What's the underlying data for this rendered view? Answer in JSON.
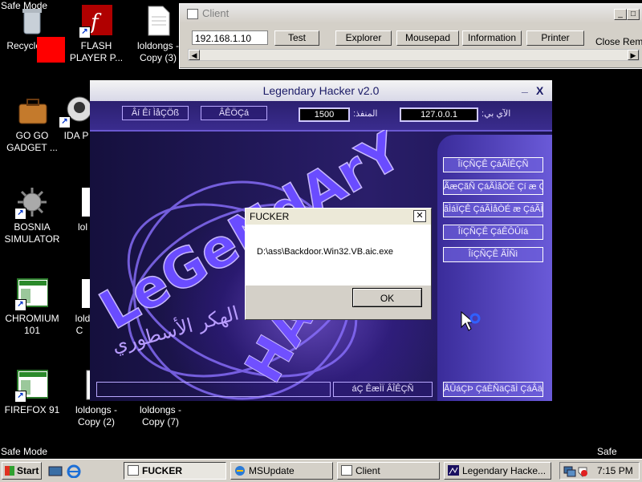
{
  "desktop": {
    "safe_mode_labels": [
      "Safe Mode",
      "Safe Mode",
      "Safe Mode"
    ],
    "icons": [
      {
        "label": "Recycle Bin"
      },
      {
        "label": "FLASH PLAYER P..."
      },
      {
        "label": "loldongs - Copy (3)"
      },
      {
        "label": "GO GO GADGET ..."
      },
      {
        "label": "IDA P"
      },
      {
        "label": "BOSNIA SIMULATOR"
      },
      {
        "label": "lol"
      },
      {
        "label": "CHROMIUM 101"
      },
      {
        "label": "lold C"
      },
      {
        "label": "FIREFOX 91"
      },
      {
        "label": "loldongs - Copy (2)"
      },
      {
        "label": "loldongs - Copy (7)"
      }
    ]
  },
  "client": {
    "title": "Client",
    "ip_value": "192.168.1.10",
    "buttons": {
      "test": "Test",
      "explorer": "Explorer",
      "mousepad": "Mousepad",
      "information": "Information",
      "printer": "Printer"
    },
    "close_remote": "Close Remo",
    "minimize": "_",
    "maximize": "□",
    "close": "✕"
  },
  "legendary": {
    "title": "Legendary Hacker v2.0",
    "minimize": "_",
    "close": "X",
    "top_buttons": [
      "Âí Êí ÌåÇÖß",
      "ÂÊÖÇá"
    ],
    "port_value": "1500",
    "port_label": ":المنفذ",
    "ip_value": "127.0.0.1",
    "ip_label": ":الآي بي",
    "logo_text": "LeGeNdArY",
    "logo_arabic": "الهكر الأسطوري",
    "logo_letters": "HAX",
    "side_buttons": [
      "ÎíÇÑÇÊ ÇáÃÎÊÇÑ",
      "ÃæÇãÑ ÇáÃÌåÒÉ Çí æ ÇáÃÌåÒÉ",
      "ãÌáÏÇÊ ÇáÃÌåÒÉ æ ÇáÃÌåÒÉ",
      "ÎíÇÑÇÊ ÇáÊÔÛíá",
      "ÎíÇÑÇÊ ÃÎÑì"
    ],
    "bottom_left_button": "áÇ ÊæÌÏ ÂÎÊÇÑ",
    "bottom_right_button": "ÅÛáÇÞ ÇáÈÑäÇãÌ ÇáÂä æ"
  },
  "dialog": {
    "title": "FUCKER",
    "message": "D:\\ass\\Backdoor.Win32.VB.aic.exe",
    "ok": "OK",
    "close": "✕"
  },
  "taskbar": {
    "start": "Start",
    "tasks": [
      {
        "label": "FUCKER",
        "active": true
      },
      {
        "label": "MSUpdate",
        "active": false
      },
      {
        "label": "Client",
        "active": false
      },
      {
        "label": "Legendary Hacke...",
        "active": false
      }
    ],
    "clock": "7:15 PM"
  },
  "colors": {
    "desktop_bg": "#000000",
    "legend_accent": "#6a58d0",
    "dialog_bg": "#d4d0c8"
  }
}
